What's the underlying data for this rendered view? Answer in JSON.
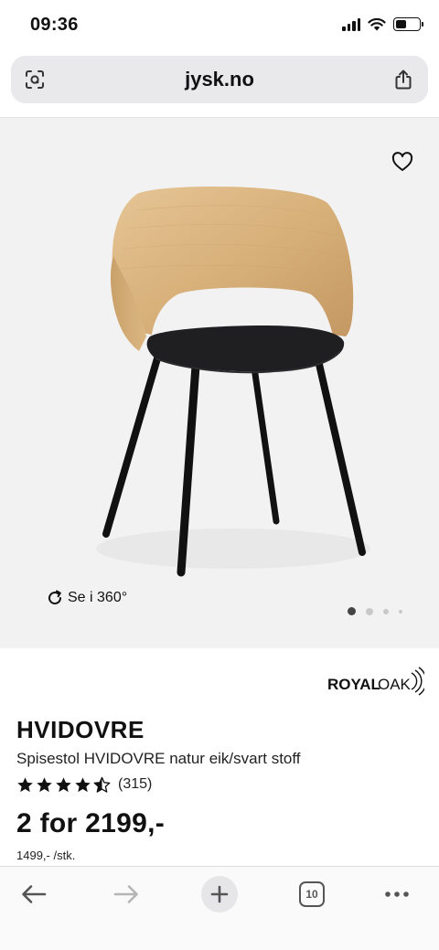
{
  "status_bar": {
    "time": "09:36"
  },
  "browser": {
    "url": "jysk.no",
    "tab_count": "10",
    "icons": {
      "left": "lens-scan-icon",
      "right": "share-icon"
    }
  },
  "gallery": {
    "view_360_label": "Se i 360°",
    "image_count": 4,
    "active_index": 0
  },
  "product": {
    "brand": {
      "part1": "ROYAL",
      "part2": "OAK"
    },
    "name": "HVIDOVRE",
    "description": "Spisestol HVIDOVRE natur eik/svart stoff",
    "rating": 4.5,
    "rating_count": "(315)",
    "price": "2 for 2199,-",
    "unit_price": "1499,- /stk."
  },
  "colors": {
    "page_bg": "#ffffff",
    "image_bg": "#f2f2f2",
    "address_bar_bg": "#e9e9eb",
    "text": "#111111",
    "oak": "#d8b27c",
    "seat": "#1f1f22"
  },
  "toolbar": {
    "items": [
      "back-icon",
      "forward-icon",
      "new-tab-icon",
      "tabs-icon",
      "more-icon"
    ]
  }
}
